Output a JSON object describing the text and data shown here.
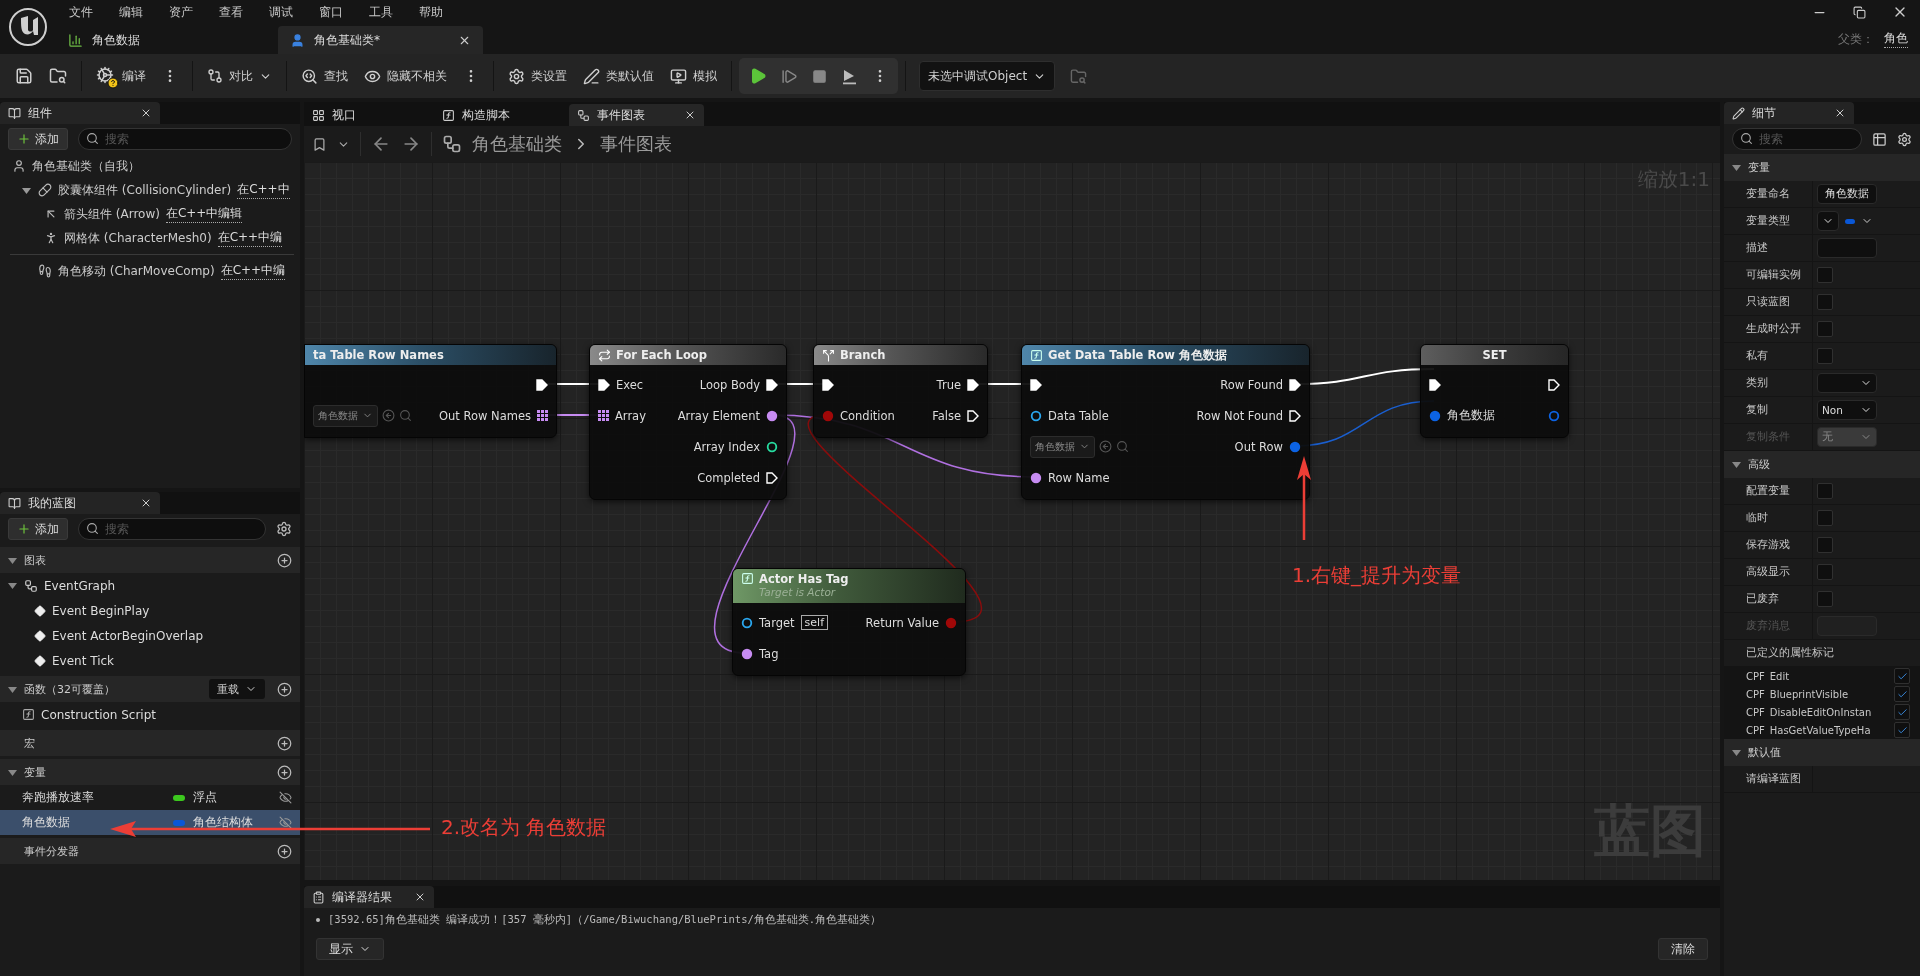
{
  "menu": [
    "文件",
    "编辑",
    "资产",
    "查看",
    "调试",
    "窗口",
    "工具",
    "帮助"
  ],
  "documents": [
    {
      "label": "角色数据",
      "kind": "datatable",
      "selected": false
    },
    {
      "label": "角色基础类*",
      "kind": "blueprint",
      "selected": true
    }
  ],
  "parent_class": {
    "label": "父类：",
    "value": "角色"
  },
  "toolbar": [
    {
      "kind": "plain",
      "items": [
        {
          "kind": "save"
        },
        {
          "kind": "browse"
        }
      ]
    },
    {
      "kind": "plain",
      "items": [
        {
          "kind": "compile",
          "label": "编译"
        },
        {
          "kind": "more"
        }
      ]
    },
    {
      "kind": "plain",
      "items": [
        {
          "kind": "diff",
          "label": "对比"
        }
      ]
    },
    {
      "kind": "plain",
      "items": [
        {
          "kind": "find",
          "label": "查找"
        },
        {
          "kind": "hide",
          "label": "隐藏不相关"
        },
        {
          "kind": "more"
        }
      ]
    },
    {
      "kind": "plain",
      "items": [
        {
          "kind": "settings",
          "label": "类设置"
        },
        {
          "kind": "defaults",
          "label": "类默认值"
        },
        {
          "kind": "simulate",
          "label": "模拟"
        }
      ]
    },
    {
      "kind": "media",
      "items": [
        {
          "kind": "play"
        },
        {
          "kind": "step"
        },
        {
          "kind": "stop"
        },
        {
          "kind": "eject"
        },
        {
          "kind": "more"
        }
      ]
    },
    {
      "kind": "plain",
      "items": [
        {
          "kind": "combo",
          "label": "未选中调试Object"
        },
        {
          "kind": "debug-browse"
        }
      ]
    }
  ],
  "components": {
    "title": "组件",
    "add": "添加",
    "search_placeholder": "搜索",
    "root": "角色基础类（自我）",
    "scene": [
      {
        "label": "胶囊体组件 (CollisionCylinder)",
        "kind": "capsule",
        "link": "在C++中",
        "expanded": true,
        "children": [
          {
            "label": "箭头组件 (Arrow)",
            "kind": "arrow",
            "link": "在C++中编辑"
          },
          {
            "label": "网格体 (CharacterMesh0)",
            "kind": "mesh",
            "link": "在C++中编"
          }
        ]
      }
    ],
    "other": [
      {
        "label": "角色移动 (CharMoveComp)",
        "kind": "movement",
        "link": "在C++中编"
      }
    ]
  },
  "my_blueprint": {
    "title": "我的蓝图",
    "add": "添加",
    "search_placeholder": "搜索",
    "sections": [
      {
        "kind": "graphs",
        "title": "图表",
        "expanded": true,
        "items": [
          {
            "label": "EventGraph",
            "expanded": true,
            "children": [
              {
                "label": "Event BeginPlay"
              },
              {
                "label": "Event ActorBeginOverlap"
              },
              {
                "label": "Event Tick"
              }
            ]
          }
        ]
      },
      {
        "kind": "functions",
        "title": "函数（32可覆盖）",
        "expanded": true,
        "override": "重载",
        "items": [
          {
            "label": "Construction Script"
          }
        ]
      },
      {
        "title": "宏"
      },
      {
        "kind": "variables",
        "title": "变量",
        "expanded": true,
        "items": [
          {
            "label": "奔跑播放速率",
            "type": "浮点",
            "color": "#3cc81e",
            "selected": false
          },
          {
            "label": "角色数据",
            "type": "角色结构体",
            "color": "#0a57d6",
            "selected": true
          }
        ]
      },
      {
        "title": "事件分发器"
      }
    ]
  },
  "graph_tabs": [
    {
      "label": "视口",
      "kind": "viewport",
      "selected": false
    },
    {
      "label": "构造脚本",
      "kind": "script",
      "selected": false
    },
    {
      "label": "事件图表",
      "kind": "graph",
      "selected": true
    }
  ],
  "breadcrumb": [
    "角色基础类",
    "事件图表"
  ],
  "zoom": "缩放1:1",
  "graph_label": "蓝图",
  "nodes": [
    {
      "title": "ta Table Row Names",
      "kind": "function",
      "rows": [
        {
          "right": {
            "kind": "exec",
            "connected": true
          }
        },
        {
          "left": {
            "kind": "asset",
            "value": "角色数据"
          },
          "right": {
            "kind": "array",
            "label": "Out Row Names",
            "connected": true
          }
        }
      ]
    },
    {
      "title": "For Each Loop",
      "kind": "macro",
      "rows": [
        {
          "left": {
            "kind": "exec",
            "label": "Exec",
            "connected": true
          },
          "right": {
            "kind": "exec",
            "label": "Loop Body",
            "connected": true
          }
        },
        {
          "left": {
            "kind": "array",
            "label": "Array",
            "connected": true
          },
          "right": {
            "kind": "name",
            "label": "Array Element",
            "connected": true
          }
        },
        {
          "right": {
            "kind": "int",
            "label": "Array Index",
            "connected": false
          }
        },
        {
          "right": {
            "kind": "exec",
            "label": "Completed",
            "connected": false
          }
        }
      ]
    },
    {
      "title": "Branch",
      "kind": "macro",
      "rows": [
        {
          "left": {
            "kind": "exec",
            "connected": true
          },
          "right": {
            "kind": "exec",
            "label": "True",
            "connected": true
          }
        },
        {
          "left": {
            "kind": "bool",
            "label": "Condition",
            "connected": true
          },
          "right": {
            "kind": "exec",
            "label": "False",
            "connected": false
          }
        }
      ]
    },
    {
      "title": "Get Data Table Row 角色数据",
      "kind": "function",
      "rows": [
        {
          "left": {
            "kind": "exec",
            "connected": true
          },
          "right": {
            "kind": "exec",
            "label": "Row Found",
            "connected": true
          }
        },
        {
          "left": {
            "kind": "object",
            "label": "Data Table",
            "connected": false
          },
          "right": {
            "kind": "exec",
            "label": "Row Not Found",
            "connected": false
          }
        },
        {
          "left": {
            "kind": "asset",
            "value": "角色数据"
          },
          "right": {
            "kind": "struct",
            "label": "Out Row",
            "connected": true
          }
        },
        {
          "left": {
            "kind": "name",
            "label": "Row Name",
            "connected": true
          }
        }
      ]
    },
    {
      "title": "SET",
      "kind": "set",
      "rows": [
        {
          "left": {
            "kind": "exec",
            "connected": true
          },
          "right": {
            "kind": "exec",
            "connected": false
          }
        },
        {
          "left": {
            "kind": "struct",
            "label": "角色数据",
            "connected": true
          },
          "right": {
            "kind": "struct",
            "connected": false
          }
        }
      ]
    },
    {
      "title": "Actor Has Tag",
      "subtitle": "Target is Actor",
      "kind": "pure",
      "rows": [
        {
          "left": {
            "kind": "object",
            "label": "Target",
            "connected": false,
            "default": "self"
          },
          "right": {
            "kind": "bool",
            "label": "Return Value",
            "connected": true
          }
        },
        {
          "left": {
            "kind": "name",
            "label": "Tag",
            "connected": true
          }
        }
      ]
    }
  ],
  "annotations": [
    {
      "text": "1.右键_提升为变量"
    },
    {
      "text": "2.改名为 角色数据"
    }
  ],
  "compiler": {
    "title": "编译器结果",
    "messages": [
      "[3592.65]角色基础类 编译成功！[357 毫秒内]（/Game/Biwuchang/BluePrints/角色基础类.角色基础类）"
    ],
    "filter": "显示",
    "clear": "清除"
  },
  "details": {
    "title": "细节",
    "search_placeholder": "搜索",
    "sections": [
      {
        "title": "变量",
        "expanded": true,
        "rows": [
          {
            "label": "变量命名",
            "kind": "text",
            "value": "角色数据"
          },
          {
            "label": "变量类型",
            "kind": "type"
          },
          {
            "label": "描述",
            "kind": "text"
          },
          {
            "label": "可编辑实例",
            "kind": "checkbox",
            "checked": false
          },
          {
            "label": "只读蓝图",
            "kind": "checkbox",
            "checked": false
          },
          {
            "label": "生成时公开",
            "kind": "checkbox",
            "checked": false
          },
          {
            "label": "私有",
            "kind": "checkbox",
            "checked": false
          },
          {
            "label": "类别",
            "kind": "combo"
          },
          {
            "label": "复制",
            "kind": "combo",
            "value": "Non",
            "disabled": false
          },
          {
            "label": "复制条件",
            "kind": "combo",
            "value": "无",
            "disabled": true
          }
        ]
      },
      {
        "title": "高级",
        "expanded": true,
        "rows": [
          {
            "label": "配置变量",
            "kind": "checkbox",
            "checked": false
          },
          {
            "label": "临时",
            "kind": "checkbox",
            "checked": false
          },
          {
            "label": "保存游戏",
            "kind": "checkbox",
            "checked": false
          },
          {
            "label": "高级显示",
            "kind": "checkbox",
            "checked": false
          },
          {
            "label": "已废弃",
            "kind": "checkbox",
            "checked": false
          },
          {
            "label": "废弃消息",
            "kind": "text",
            "disabled": true
          },
          {
            "label": "已定义的属性标记",
            "kind": "flags",
            "flags": [
              {
                "label": "CPF_Edit",
                "checked": true
              },
              {
                "label": "CPF_BlueprintVisible",
                "checked": true
              },
              {
                "label": "CPF_DisableEditOnInstan",
                "checked": true
              },
              {
                "label": "CPF_HasGetValueTypeHa",
                "checked": true
              }
            ]
          }
        ]
      },
      {
        "title": "默认值",
        "expanded": true,
        "rows": [
          {
            "label": "请编译蓝图",
            "kind": "label"
          }
        ]
      }
    ]
  }
}
